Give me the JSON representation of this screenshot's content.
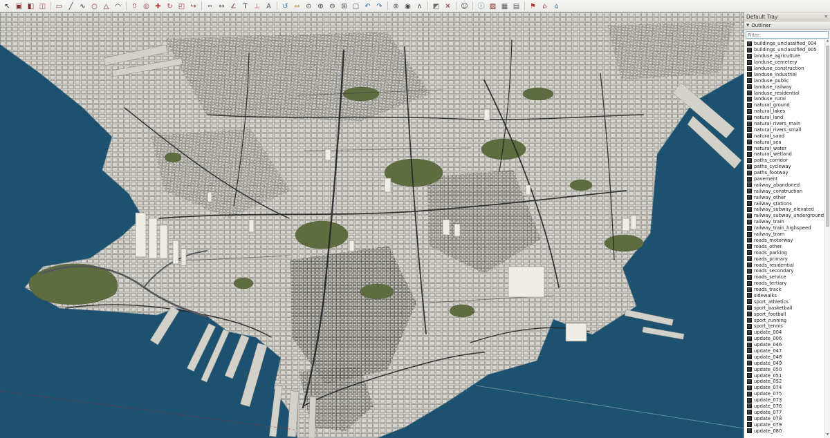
{
  "toolbar": {
    "icons": [
      {
        "name": "select",
        "glyph": "↖",
        "color": "#222222"
      },
      {
        "name": "make-component",
        "glyph": "▣",
        "color": "#7d2b2b"
      },
      {
        "name": "paint-bucket",
        "glyph": "◧",
        "color": "#7d2b2b"
      },
      {
        "name": "eraser",
        "glyph": "◫",
        "color": "#a85454"
      },
      {
        "sep": true
      },
      {
        "name": "rectangle",
        "glyph": "▭",
        "color": "#7d2b2b"
      },
      {
        "name": "line",
        "glyph": "╱",
        "color": "#333333"
      },
      {
        "name": "freehand",
        "glyph": "∿",
        "color": "#333333"
      },
      {
        "name": "circle",
        "glyph": "○",
        "color": "#7d2b2b"
      },
      {
        "name": "polygon",
        "glyph": "△",
        "color": "#7d2b2b"
      },
      {
        "name": "arc",
        "glyph": "◠",
        "color": "#7d2b2b"
      },
      {
        "sep": true
      },
      {
        "name": "push-pull",
        "glyph": "⇧",
        "color": "#8a3434"
      },
      {
        "name": "offset",
        "glyph": "◎",
        "color": "#8a3434"
      },
      {
        "name": "move",
        "glyph": "✚",
        "color": "#b33a3a"
      },
      {
        "name": "rotate",
        "glyph": "↻",
        "color": "#b33a3a"
      },
      {
        "name": "scale",
        "glyph": "◰",
        "color": "#b33a3a"
      },
      {
        "name": "follow-me",
        "glyph": "↪",
        "color": "#8a3434"
      },
      {
        "sep": true
      },
      {
        "name": "tape-measure",
        "glyph": "┅",
        "color": "#555555"
      },
      {
        "name": "dimension",
        "glyph": "↔",
        "color": "#555555"
      },
      {
        "name": "protractor",
        "glyph": "∠",
        "color": "#8a3434"
      },
      {
        "name": "text",
        "glyph": "T",
        "color": "#333333"
      },
      {
        "name": "axes",
        "glyph": "⊥",
        "color": "#c03333"
      },
      {
        "name": "3d-text",
        "glyph": "A",
        "color": "#555555"
      },
      {
        "sep": true
      },
      {
        "name": "orbit",
        "glyph": "↺",
        "color": "#2e6e93"
      },
      {
        "name": "pan",
        "glyph": "⇔",
        "color": "#c89b3c"
      },
      {
        "name": "zoom",
        "glyph": "⊙",
        "color": "#444444"
      },
      {
        "name": "zoom-in",
        "glyph": "⊕",
        "color": "#444444"
      },
      {
        "name": "zoom-out",
        "glyph": "⊖",
        "color": "#444444"
      },
      {
        "name": "zoom-window",
        "glyph": "⊞",
        "color": "#444444"
      },
      {
        "name": "zoom-extents",
        "glyph": "▢",
        "color": "#3a7d3a"
      },
      {
        "name": "previous-view",
        "glyph": "↶",
        "color": "#3a6ea5"
      },
      {
        "name": "next-view",
        "glyph": "↷",
        "color": "#3a6ea5"
      },
      {
        "sep": true
      },
      {
        "name": "position-camera",
        "glyph": "⊚",
        "color": "#444444"
      },
      {
        "name": "look-around",
        "glyph": "◉",
        "color": "#444444"
      },
      {
        "name": "walk",
        "glyph": "∧",
        "color": "#444444"
      },
      {
        "sep": true
      },
      {
        "name": "section-plane",
        "glyph": "◩",
        "color": "#6b6b66"
      },
      {
        "name": "delete-guides",
        "glyph": "✕",
        "color": "#8a3434"
      },
      {
        "sep": true
      },
      {
        "name": "account",
        "glyph": "☺",
        "color": "#444444"
      },
      {
        "sep": true
      },
      {
        "name": "model-info",
        "glyph": "ⓘ",
        "color": "#2e6e93"
      },
      {
        "name": "materials",
        "glyph": "▨",
        "color": "#7d2b2b"
      },
      {
        "name": "components",
        "glyph": "▦",
        "color": "#555555"
      },
      {
        "name": "styles",
        "glyph": "▤",
        "color": "#555555"
      },
      {
        "sep": true
      },
      {
        "name": "add-location",
        "glyph": "⚑",
        "color": "#b33a3a"
      },
      {
        "name": "3d-warehouse",
        "glyph": "⌂",
        "color": "#b33a3a"
      },
      {
        "name": "extension-warehouse",
        "glyph": "⌂",
        "color": "#2e6e93"
      }
    ]
  },
  "tray": {
    "title": "Default Tray",
    "close_glyph": "✕",
    "outliner": {
      "title": "Outliner",
      "collapse_glyph": "▼",
      "filter_placeholder": "Filter:",
      "scroll_up_glyph": "▲",
      "scroll_down_glyph": "▼",
      "items": [
        "buildings_unclassified_004",
        "buildings_unclassified_005",
        "landuse_agriculture",
        "landuse_cemetery",
        "landuse_construction",
        "landuse_industrial",
        "landuse_public",
        "landuse_railway",
        "landuse_residential",
        "landuse_rural",
        "natural_ground",
        "natural_lakes",
        "natural_land",
        "natural_rivers_main",
        "natural_rivers_small",
        "natural_sand",
        "natural_sea",
        "natural_water",
        "natural_wetland",
        "paths_corridor",
        "paths_cycleway",
        "paths_footway",
        "pavement",
        "railway_abandoned",
        "railway_construction",
        "railway_other",
        "railway_stations",
        "railway_subway_elevated",
        "railway_subway_underground",
        "railway_train",
        "railway_train_highspeed",
        "railway_tram",
        "roads_motorway",
        "roads_other",
        "roads_parking",
        "roads_primary",
        "roads_residential",
        "roads_secondary",
        "roads_service",
        "roads_tertiary",
        "roads_track",
        "sidewalks",
        "sport_athletics",
        "sport_basketball",
        "sport_football",
        "sport_running",
        "sport_tennis",
        "update_004",
        "update_006",
        "update_046",
        "update_047",
        "update_048",
        "update_049",
        "update_050",
        "update_051",
        "update_052",
        "update_074",
        "update_075",
        "update_073",
        "update_076",
        "update_077",
        "update_078",
        "update_079",
        "update_080"
      ]
    }
  },
  "viewport": {
    "colors": {
      "water": "#1c5170",
      "land": "#c8c6bf",
      "park": "#5d6d40",
      "road": "#242424",
      "pier": "#d2d1ca",
      "tower": "#efede6",
      "axis_red": "#cc2222"
    }
  }
}
